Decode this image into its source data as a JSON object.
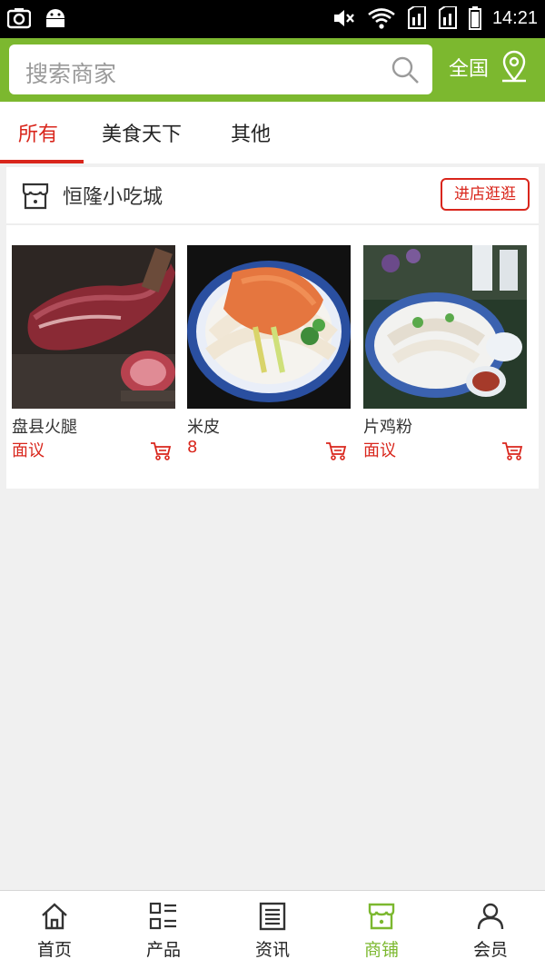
{
  "status_bar": {
    "time": "14:21"
  },
  "header": {
    "search_placeholder": "搜索商家",
    "region": "全国",
    "brand_color": "#7cb82f",
    "icons": [
      "search-icon",
      "location-icon"
    ]
  },
  "tabs": [
    {
      "label": "所有",
      "active": true
    },
    {
      "label": "美食天下",
      "active": false
    },
    {
      "label": "其他",
      "active": false
    }
  ],
  "store": {
    "name": "恒隆小吃城",
    "visit_label": "进店逛逛",
    "accent_color": "#d9261c",
    "products": [
      {
        "name": "盘县火腿",
        "price": "面议",
        "image": "ham"
      },
      {
        "name": "米皮",
        "price": "8",
        "image": "rice-noodles"
      },
      {
        "name": "片鸡粉",
        "price": "面议",
        "image": "chicken-noodles"
      }
    ]
  },
  "bottom_nav": [
    {
      "label": "首页",
      "icon": "home-icon",
      "active": false
    },
    {
      "label": "产品",
      "icon": "grid-list-icon",
      "active": false
    },
    {
      "label": "资讯",
      "icon": "news-icon",
      "active": false
    },
    {
      "label": "商铺",
      "icon": "store-icon",
      "active": true
    },
    {
      "label": "会员",
      "icon": "user-icon",
      "active": false
    }
  ]
}
